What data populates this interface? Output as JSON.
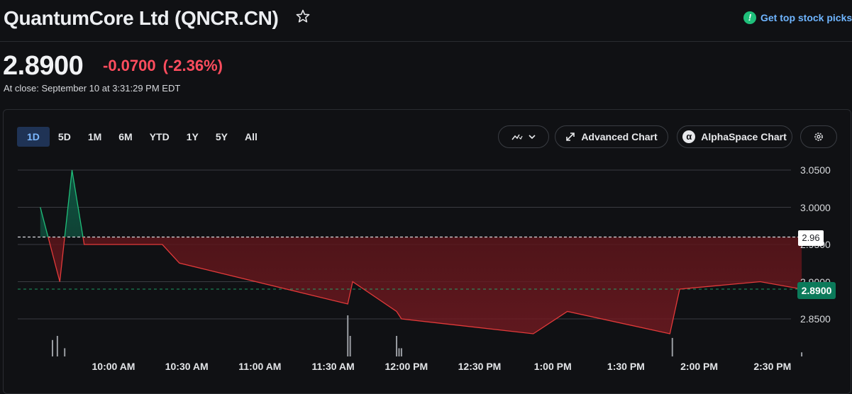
{
  "header": {
    "title": "QuantumCore Ltd (QNCR.CN)",
    "picks_label": "Get top stock picks",
    "star_icon": "star-outline-icon"
  },
  "quote": {
    "price": "2.8900",
    "change": "-0.0700",
    "change_pct": "(-2.36%)",
    "close_time": "At close: September 10 at 3:31:29 PM EDT",
    "negative_color": "#ff4d5e"
  },
  "range_tabs": [
    {
      "label": "1D",
      "active": true
    },
    {
      "label": "5D",
      "active": false
    },
    {
      "label": "1M",
      "active": false
    },
    {
      "label": "6M",
      "active": false
    },
    {
      "label": "YTD",
      "active": false
    },
    {
      "label": "1Y",
      "active": false
    },
    {
      "label": "5Y",
      "active": false
    },
    {
      "label": "All",
      "active": false
    }
  ],
  "toolbar": {
    "chart_type_icon": "chart-type-icon",
    "advanced_chart": "Advanced Chart",
    "alphaspace_chart": "AlphaSpace Chart",
    "settings_icon": "gear-icon"
  },
  "chart_data": {
    "type": "area",
    "x_labels": [
      "10:00 AM",
      "10:30 AM",
      "11:00 AM",
      "11:30 AM",
      "12:00 PM",
      "12:30 PM",
      "1:00 PM",
      "1:30 PM",
      "2:00 PM",
      "2:30 PM"
    ],
    "y_ticks": [
      "3.0500",
      "3.0000",
      "2.9500",
      "2.9000",
      "2.8500"
    ],
    "ylim": [
      2.82,
      3.06
    ],
    "previous_close": 2.96,
    "previous_close_label": "2.96",
    "last_price_label": "2.8900",
    "colors": {
      "above": "#1fbf7a",
      "below": "#e23a3a"
    },
    "price_series": [
      {
        "t": "09:30",
        "v": 3.0
      },
      {
        "t": "09:38",
        "v": 2.9
      },
      {
        "t": "09:43",
        "v": 3.05
      },
      {
        "t": "09:48",
        "v": 2.95
      },
      {
        "t": "10:20",
        "v": 2.95
      },
      {
        "t": "10:27",
        "v": 2.925
      },
      {
        "t": "11:36",
        "v": 2.87
      },
      {
        "t": "11:38",
        "v": 2.9
      },
      {
        "t": "11:56",
        "v": 2.86
      },
      {
        "t": "11:58",
        "v": 2.85
      },
      {
        "t": "12:52",
        "v": 2.83
      },
      {
        "t": "13:06",
        "v": 2.86
      },
      {
        "t": "13:48",
        "v": 2.83
      },
      {
        "t": "13:52",
        "v": 2.89
      },
      {
        "t": "14:25",
        "v": 2.9
      },
      {
        "t": "14:42",
        "v": 2.89
      }
    ],
    "volume_bars": [
      {
        "t": "09:35",
        "v": 0.4
      },
      {
        "t": "09:37",
        "v": 0.5
      },
      {
        "t": "09:40",
        "v": 0.2
      },
      {
        "t": "11:36",
        "v": 1.0
      },
      {
        "t": "11:37",
        "v": 0.5
      },
      {
        "t": "11:56",
        "v": 0.5
      },
      {
        "t": "11:57",
        "v": 0.2
      },
      {
        "t": "11:58",
        "v": 0.2
      },
      {
        "t": "13:49",
        "v": 0.45
      },
      {
        "t": "14:42",
        "v": 0.1
      }
    ]
  }
}
